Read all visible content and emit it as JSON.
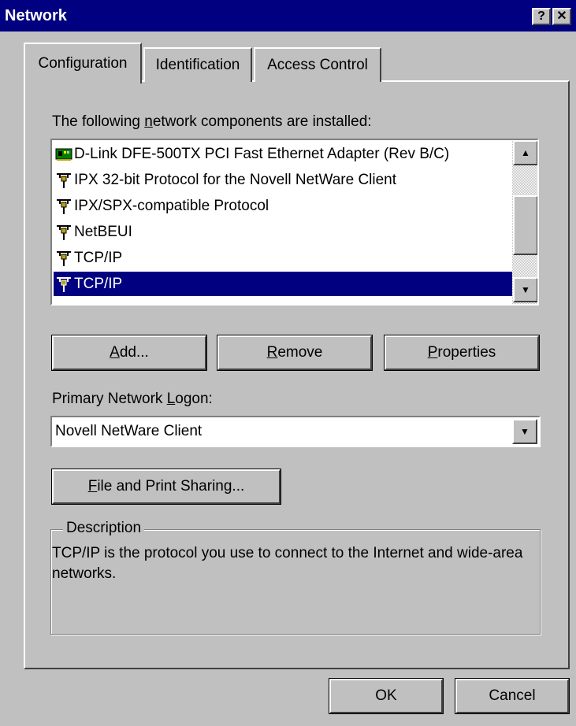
{
  "window": {
    "title": "Network"
  },
  "titlebar": {
    "help_glyph": "?",
    "close_glyph": "✕"
  },
  "tabs": [
    {
      "label": "Configuration",
      "active": true
    },
    {
      "label": "Identification",
      "active": false
    },
    {
      "label": "Access Control",
      "active": false
    }
  ],
  "components": {
    "label_prefix": "The following ",
    "label_mnemonic": "n",
    "label_suffix": "etwork components are installed:",
    "items": [
      {
        "label": "D-Link DFE-500TX PCI Fast Ethernet Adapter (Rev B/C)",
        "icon": "network-adapter-icon",
        "selected": false
      },
      {
        "label": "IPX 32-bit Protocol for the Novell NetWare Client",
        "icon": "protocol-icon",
        "selected": false
      },
      {
        "label": "IPX/SPX-compatible Protocol",
        "icon": "protocol-icon",
        "selected": false
      },
      {
        "label": "NetBEUI",
        "icon": "protocol-icon",
        "selected": false
      },
      {
        "label": "TCP/IP",
        "icon": "protocol-icon",
        "selected": false
      },
      {
        "label": "TCP/IP",
        "icon": "protocol-icon",
        "selected": true
      }
    ]
  },
  "buttons": {
    "add": {
      "mnemonic": "A",
      "rest": "dd..."
    },
    "remove": {
      "mnemonic": "R",
      "rest": "emove"
    },
    "properties": {
      "mnemonic": "P",
      "rest": "roperties"
    },
    "file_print": {
      "mnemonic": "F",
      "rest": "ile and Print Sharing..."
    },
    "ok": "OK",
    "cancel": "Cancel"
  },
  "logon": {
    "label_prefix": "Primary Network ",
    "label_mnemonic": "L",
    "label_suffix": "ogon:",
    "value": "Novell NetWare Client"
  },
  "description": {
    "legend": "Description",
    "text": "TCP/IP is the protocol you use to connect to the Internet and wide-area networks."
  },
  "colors": {
    "selection": "#000080",
    "face": "#c0c0c0",
    "titlebar": "#000080"
  }
}
